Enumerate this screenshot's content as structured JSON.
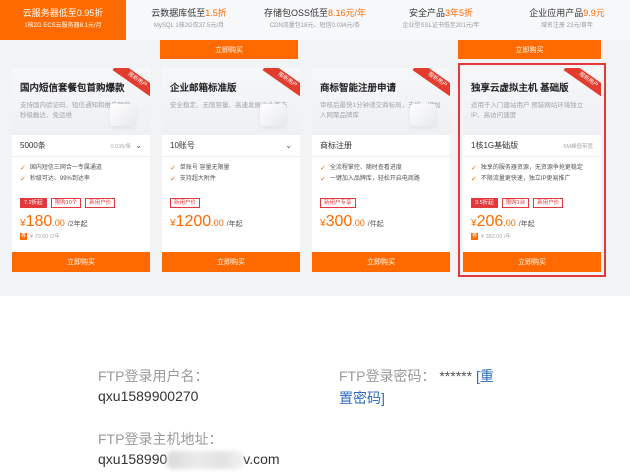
{
  "tabs": [
    {
      "pre": "云服务器低至",
      "hl": "0.95折",
      "sub": "1核2G ECS云服务器8.1元/月",
      "active": true
    },
    {
      "pre": "云数据库低至",
      "hl": "1.5折",
      "sub": "MySQL 1核2G仅37.5元/月",
      "active": false
    },
    {
      "pre": "存储包OSS低至",
      "hl": "8.16元/年",
      "sub": "CDN流量包18元、短信0.034元/条",
      "active": false
    },
    {
      "pre": "安全产品",
      "hl": "3年5折",
      "sub": "企业型SSL证书低至201元/年",
      "active": false
    },
    {
      "pre": "企业应用产品",
      "hl": "9.9元",
      "sub": "域名注册 23元/首年",
      "active": false
    }
  ],
  "upper_buttons": [
    "立即购买",
    "立即购买"
  ],
  "cards": [
    {
      "ribbon": "限新用户",
      "title": "国内短信套餐包首购爆款",
      "desc": "支持国内验证码、短信通知和推广短信，秒级触达、免运维",
      "select_value": "5000条",
      "select_note": "0.036/条",
      "features": [
        "国内短信三网合一专属通道",
        "秒级可达、99%到达率"
      ],
      "badges": [
        {
          "text": "7.2折起",
          "solid": true
        },
        {
          "text": "限购10个",
          "solid": false
        },
        {
          "text": "新用户价",
          "solid": false
        }
      ],
      "price_int": "180",
      "price_dec": ".00",
      "price_unit": "/2年起",
      "orig": "¥ 70.00 /2年",
      "buy": "立即购买"
    },
    {
      "ribbon": "限新用户",
      "title": "企业邮箱标准版",
      "desc": "安全稳定、无限容量、高速发展企业首选",
      "select_value": "10账号",
      "select_note": "",
      "features": [
        "单账号 容量无限量",
        "支持超大附件"
      ],
      "badges": [
        {
          "text": "新用户价",
          "solid": false
        }
      ],
      "price_int": "1200",
      "price_dec": ".00",
      "price_unit": "/年起",
      "orig": "",
      "buy": "立即购买"
    },
    {
      "ribbon": "限新用户",
      "title": "商标智能注册申请",
      "desc": "审核后最快1分钟递交商标局，支持一键加入网聚品牌库",
      "select_value": "商标注册",
      "select_note": "",
      "features": [
        "全流程掌控、随时查看进度",
        "一键加入品牌库，轻松开启电商路"
      ],
      "badges": [
        {
          "text": "新用户专享",
          "solid": false
        }
      ],
      "price_int": "300",
      "price_dec": ".00",
      "price_unit": "/件起",
      "orig": "",
      "buy": "立即购买"
    },
    {
      "ribbon": "限新用户",
      "title": "独享云虚拟主机 基础版",
      "desc": "适用于入门建站用户 预装网站环境独立IP、高访问速度",
      "select_value": "1核1G基础版",
      "select_note": "5M峰值带宽",
      "features": [
        "独享的服务器资源，无资源争抢更稳定",
        "不限流量更快速，独立IP更易推广"
      ],
      "badges": [
        {
          "text": "3.5折起",
          "solid": true
        },
        {
          "text": "限购1台",
          "solid": false
        },
        {
          "text": "新用户价",
          "solid": false
        }
      ],
      "price_int": "206",
      "price_dec": ".00",
      "price_unit": "/年起",
      "orig": "¥ 382.00 /年",
      "buy": "立即购买"
    }
  ],
  "ftp": {
    "username_label": "FTP登录用户名：",
    "username_value": "qxu1589900270",
    "password_label": "FTP登录密码：",
    "password_mask": "******",
    "reset_link_open": "[重",
    "reset_link_close": "置密码]",
    "host_label": "FTP登录主机地址：",
    "host_value_prefix": "qxu158990",
    "host_value_suffix": "v.com"
  },
  "colors": {
    "accent": "#ff6a00",
    "selected_outline": "#e4393c",
    "link": "#2d6cc0"
  }
}
